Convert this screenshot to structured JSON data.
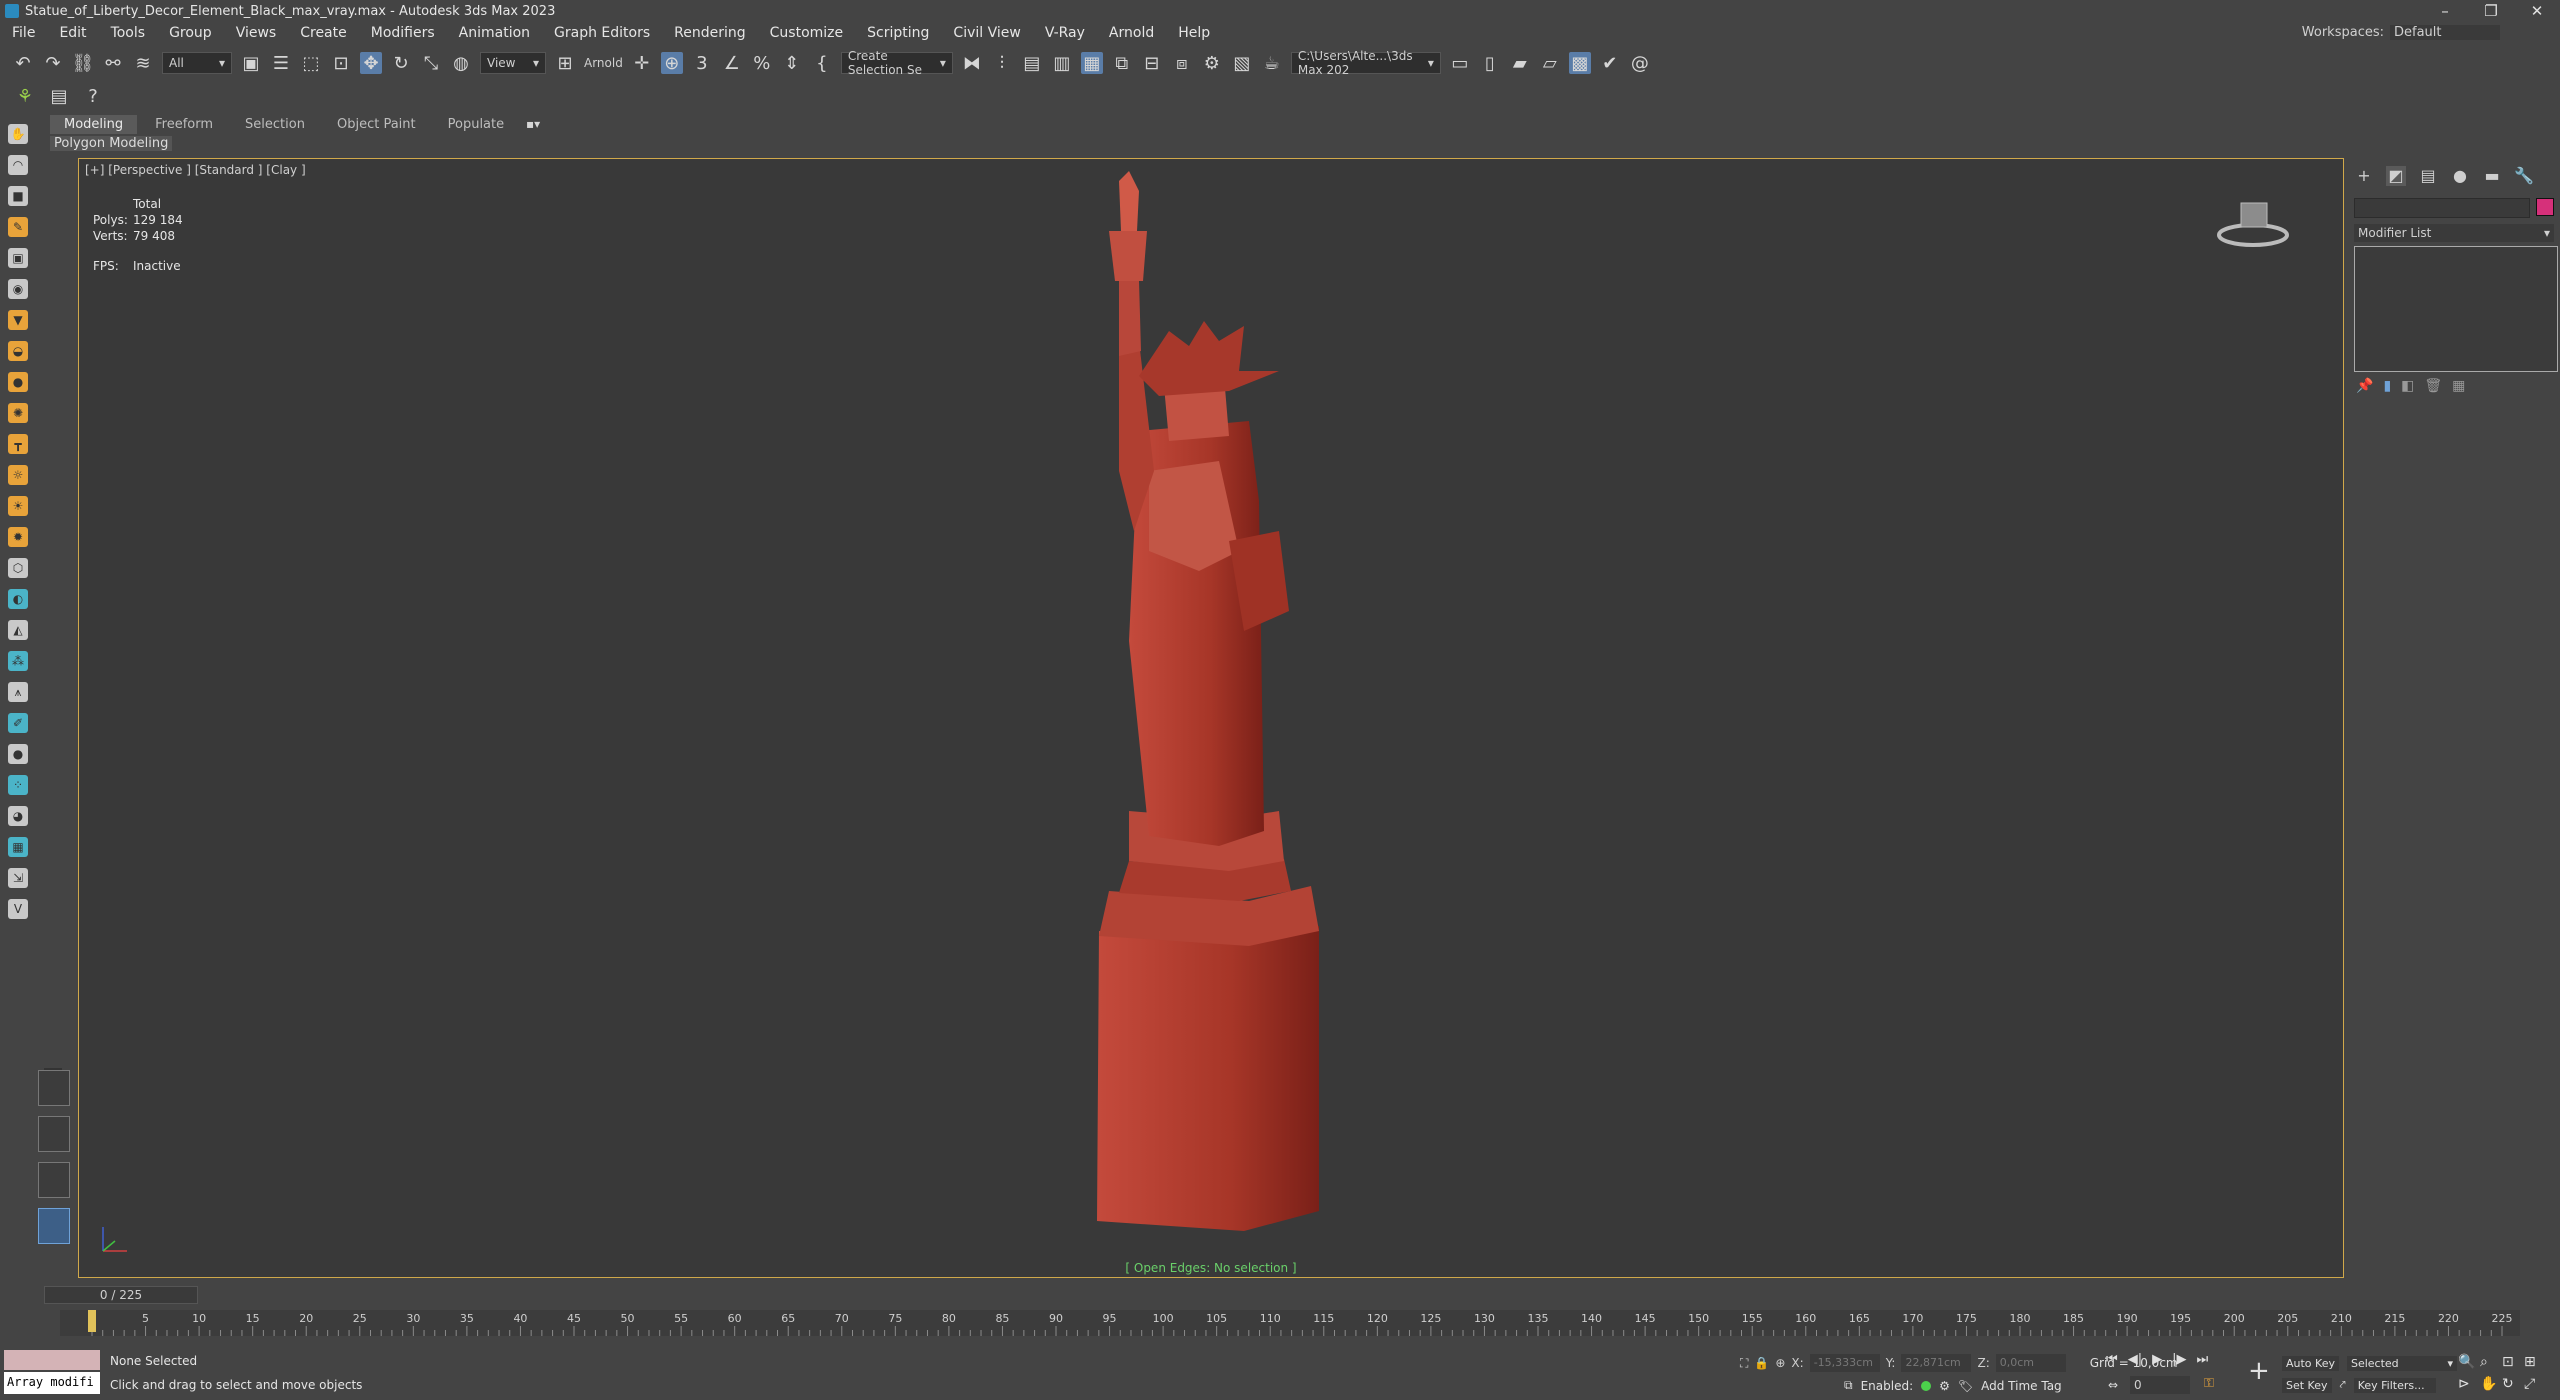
{
  "window": {
    "title": "Statue_of_Liberty_Decor_Element_Black_max_vray.max - Autodesk 3ds Max 2023",
    "controls": [
      "–",
      "❐",
      "✕"
    ]
  },
  "menu": [
    "File",
    "Edit",
    "Tools",
    "Group",
    "Views",
    "Create",
    "Modifiers",
    "Animation",
    "Graph Editors",
    "Rendering",
    "Customize",
    "Scripting",
    "Civil View",
    "V-Ray",
    "Arnold",
    "Help"
  ],
  "workspaces": {
    "label": "Workspaces:",
    "value": "Default"
  },
  "toolbar": {
    "selection_filter": "All",
    "reference_coord": "View",
    "arnold_label": "Arnold",
    "named_selection": "Create Selection Se",
    "project_path": "C:\\Users\\Alte...\\3ds Max 202"
  },
  "ribbon": {
    "tabs": [
      "Modeling",
      "Freeform",
      "Selection",
      "Object Paint",
      "Populate"
    ],
    "active_tab": "Modeling",
    "sub_label": "Polygon Modeling"
  },
  "viewport": {
    "label": "[+] [Perspective ] [Standard ] [Clay ]",
    "stats": {
      "header": "Total",
      "polys_label": "Polys:",
      "polys_value": "129 184",
      "verts_label": "Verts:",
      "verts_value": "79 408",
      "fps_label": "FPS:",
      "fps_value": "Inactive"
    },
    "status": "[ Open Edges: No selection ]",
    "model_color": "#a9382c"
  },
  "command_panel": {
    "modifier_list": "Modifier List",
    "color_swatch": "#d6307a"
  },
  "timeline": {
    "slider_label": "0 / 225",
    "ticks": [
      "5",
      "10",
      "15",
      "20",
      "25",
      "30",
      "35",
      "40",
      "45",
      "50",
      "55",
      "60",
      "65",
      "70",
      "75",
      "80",
      "85",
      "90",
      "95",
      "100",
      "105",
      "110",
      "115",
      "120",
      "125",
      "130",
      "135",
      "140",
      "145",
      "150",
      "155",
      "160",
      "165",
      "170",
      "175",
      "180",
      "185",
      "190",
      "195",
      "200",
      "205",
      "210",
      "215",
      "220",
      "225"
    ],
    "current_frame": 0,
    "total_frames": 225
  },
  "status": {
    "listener_text": "Array modifi",
    "selection": "None Selected",
    "prompt": "Click and drag to select and move objects",
    "x_label": "X:",
    "x_value": "-15,333cm",
    "y_label": "Y:",
    "y_value": "22,871cm",
    "z_label": "Z:",
    "z_value": "0,0cm",
    "grid": "Grid = 10,0cm",
    "enabled_label": "Enabled:",
    "add_time_tag": "Add Time Tag",
    "frame_value": "0",
    "auto_key": "Auto Key",
    "set_key": "Set Key",
    "key_mode": "Selected",
    "key_filters": "Key Filters..."
  }
}
